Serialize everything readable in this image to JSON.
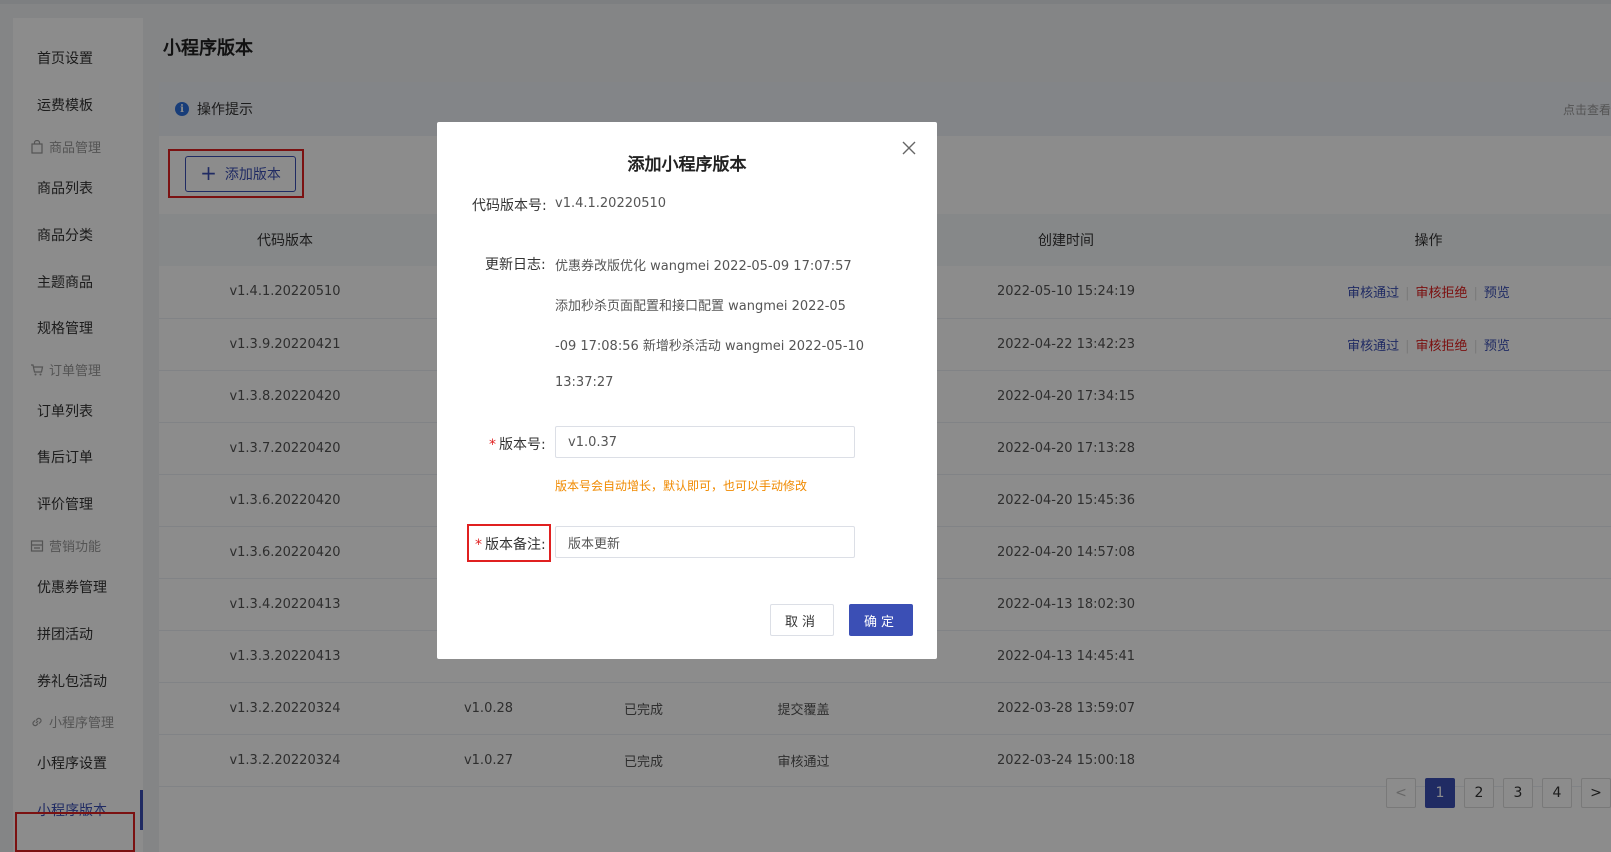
{
  "sidebar": {
    "items": [
      {
        "label": "首页设置",
        "type": "item"
      },
      {
        "label": "运费模板",
        "type": "item"
      },
      {
        "label": "商品管理",
        "type": "group",
        "icon": "bag-icon"
      },
      {
        "label": "商品列表",
        "type": "item"
      },
      {
        "label": "商品分类",
        "type": "item"
      },
      {
        "label": "主题商品",
        "type": "item"
      },
      {
        "label": "规格管理",
        "type": "item"
      },
      {
        "label": "订单管理",
        "type": "group",
        "icon": "cart-icon"
      },
      {
        "label": "订单列表",
        "type": "item"
      },
      {
        "label": "售后订单",
        "type": "item"
      },
      {
        "label": "评价管理",
        "type": "item"
      },
      {
        "label": "营销功能",
        "type": "group",
        "icon": "shop-icon"
      },
      {
        "label": "优惠券管理",
        "type": "item"
      },
      {
        "label": "拼团活动",
        "type": "item"
      },
      {
        "label": "券礼包活动",
        "type": "item"
      },
      {
        "label": "小程序管理",
        "type": "group",
        "icon": "link-icon"
      },
      {
        "label": "小程序设置",
        "type": "item"
      },
      {
        "label": "小程序版本",
        "type": "item",
        "active": true
      }
    ]
  },
  "header": {
    "title": "小程序版本",
    "tips_label": "操作提示",
    "tips_right": "点击查看"
  },
  "toolbar": {
    "add_label": "添加版本"
  },
  "table": {
    "columns": [
      "代码版本",
      "",
      "",
      "",
      "创建时间",
      "操作"
    ],
    "rows": [
      {
        "code": "v1.4.1.20220510",
        "ver": "",
        "status": "",
        "audit": "",
        "audit_color": "",
        "created": "2022-05-10 15:24:19",
        "ops": true
      },
      {
        "code": "v1.3.9.20220421",
        "ver": "",
        "status": "",
        "audit": "",
        "audit_color": "",
        "created": "2022-04-22 13:42:23",
        "ops": true
      },
      {
        "code": "v1.3.8.20220420",
        "ver": "",
        "status": "",
        "audit": "",
        "audit_color": "",
        "created": "2022-04-20 17:34:15",
        "ops": false
      },
      {
        "code": "v1.3.7.20220420",
        "ver": "",
        "status": "",
        "audit": "",
        "audit_color": "",
        "created": "2022-04-20 17:13:28",
        "ops": false
      },
      {
        "code": "v1.3.6.20220420",
        "ver": "",
        "status": "",
        "audit": "",
        "audit_color": "",
        "created": "2022-04-20 15:45:36",
        "ops": false
      },
      {
        "code": "v1.3.6.20220420",
        "ver": "",
        "status": "",
        "audit": "",
        "audit_color": "",
        "created": "2022-04-20 14:57:08",
        "ops": false
      },
      {
        "code": "v1.3.4.20220413",
        "ver": "",
        "status": "",
        "audit": "",
        "audit_color": "",
        "created": "2022-04-13 18:02:30",
        "ops": false
      },
      {
        "code": "v1.3.3.20220413",
        "ver": "",
        "status": "",
        "audit": "",
        "audit_color": "",
        "created": "2022-04-13 14:45:41",
        "ops": false
      },
      {
        "code": "v1.3.2.20220324",
        "ver": "v1.0.28",
        "status": "已完成",
        "audit": "提交覆盖",
        "audit_color": "orange",
        "created": "2022-03-28 13:59:07",
        "ops": false
      },
      {
        "code": "v1.3.2.20220324",
        "ver": "v1.0.27",
        "status": "已完成",
        "audit": "审核通过",
        "audit_color": "green",
        "created": "2022-03-24 15:00:18",
        "ops": false
      }
    ],
    "ops": {
      "pass": "审核通过",
      "reject": "审核拒绝",
      "preview": "预览"
    }
  },
  "pager": {
    "prev": "<",
    "pages": [
      "1",
      "2",
      "3",
      "4"
    ],
    "next": ">",
    "active": "1"
  },
  "modal": {
    "title": "添加小程序版本",
    "code_label": "代码版本号:",
    "code_value": "v1.4.1.20220510",
    "log_label": "更新日志:",
    "log_lines": [
      "优惠券改版优化 wangmei 2022-05-09 17:07:57",
      "添加秒杀页面配置和接口配置 wangmei 2022-05",
      "-09 17:08:56 新增秒杀活动 wangmei 2022-05-10",
      "13:37:27"
    ],
    "version_label": "版本号:",
    "version_value": "v1.0.37",
    "version_hint": "版本号会自动增长，默认即可，也可以手动修改",
    "remark_label": "版本备注:",
    "remark_value": "版本更新",
    "cancel_label": "取消",
    "ok_label": "确定",
    "star": "*"
  }
}
